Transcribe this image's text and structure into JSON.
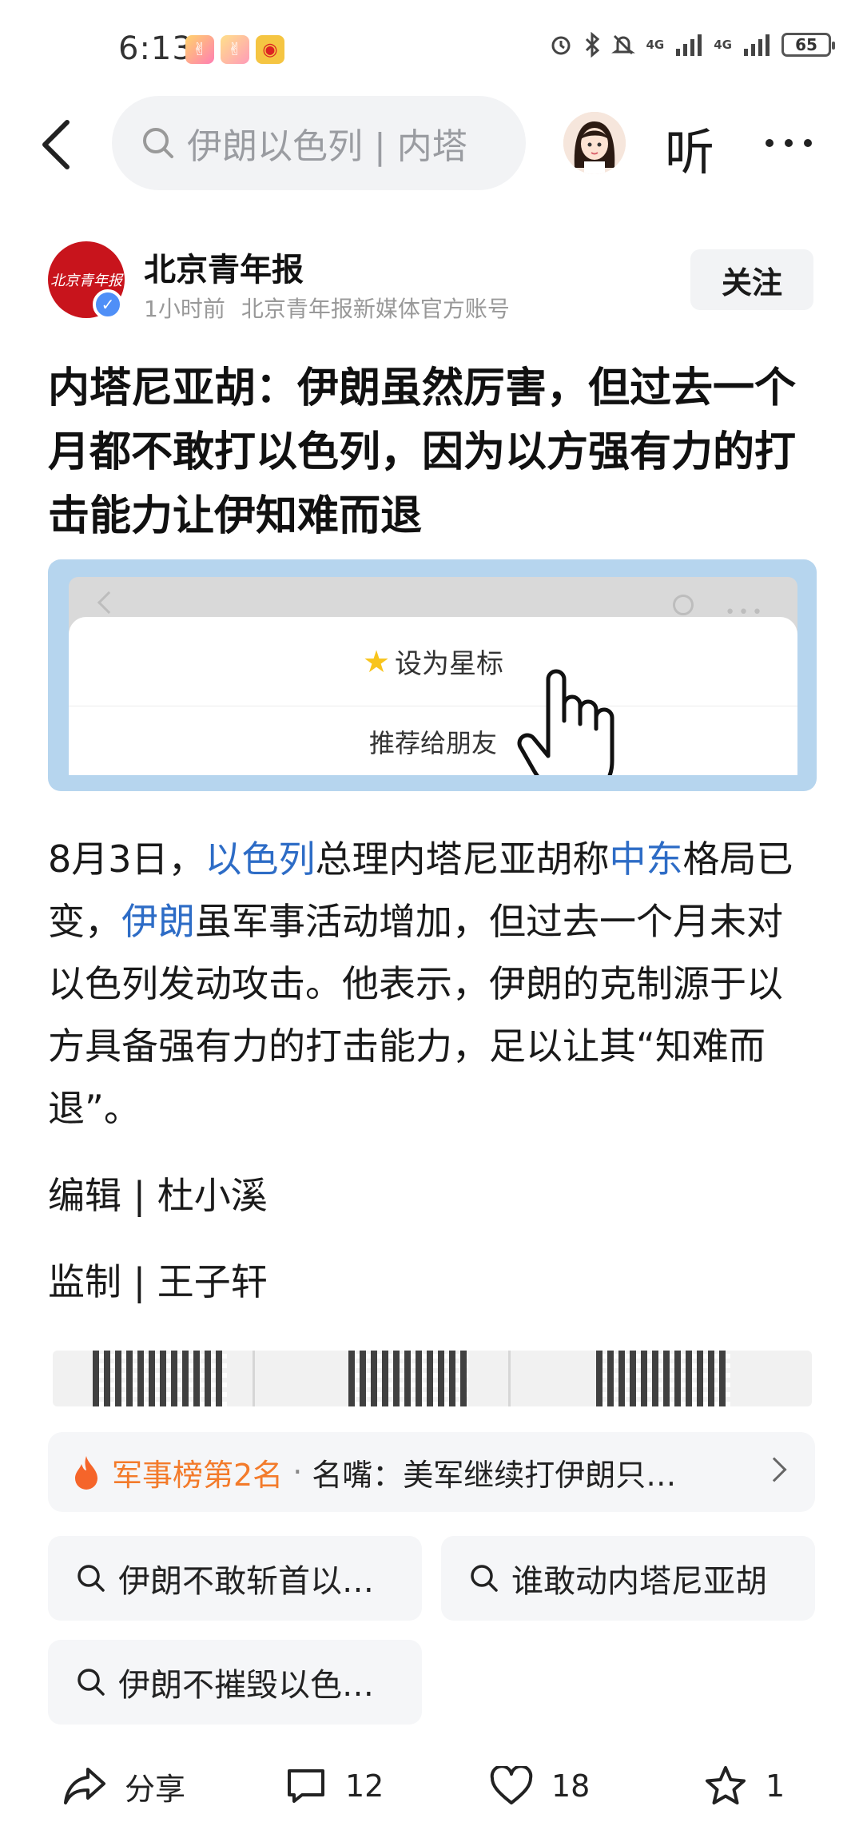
{
  "status_bar": {
    "time": "6:13",
    "network_1": "4G",
    "network_2": "4G",
    "battery": "65"
  },
  "nav": {
    "search_text": "伊朗以色列 | 内塔",
    "listen_label": "听"
  },
  "author": {
    "logo_text": "北京青年报",
    "name": "北京青年报",
    "time": "1小时前",
    "description": "北京青年报新媒体官方账号",
    "follow_label": "关注"
  },
  "article": {
    "title": "内塔尼亚胡：伊朗虽然厉害，但过去一个月都不敢打以色列，因为以方强有力的打击能力让伊知难而退",
    "embed": {
      "star_label": "设为星标",
      "recommend_label": "推荐给朋友"
    },
    "body": {
      "p1": "8月3日，",
      "link1": "以色列",
      "p2": "总理内塔尼亚胡称",
      "link2": "中东",
      "p3": "格局已变，",
      "link3": "伊朗",
      "p4": "虽军事活动增加，但过去一个月未对以色列发动攻击。他表示，伊朗的克制源于以方具备强有力的打击能力，足以让其“知难而退”。"
    },
    "editor": "编辑 | 杜小溪",
    "supervisor": "监制 | 王子轩"
  },
  "ranking": {
    "label": "军事榜第2名",
    "dot": "·",
    "text": "名嘴：美军继续打伊朗只…"
  },
  "related_searches": [
    "伊朗不敢斩首以…",
    "谁敢动内塔尼亚胡",
    "伊朗不摧毁以色…"
  ],
  "actions": {
    "share": "分享",
    "comments": "12",
    "likes": "18",
    "favorites": "1"
  },
  "colors": {
    "link": "#2d6cc6",
    "rank_accent": "#f37b2b",
    "brand_red": "#c8141c"
  }
}
